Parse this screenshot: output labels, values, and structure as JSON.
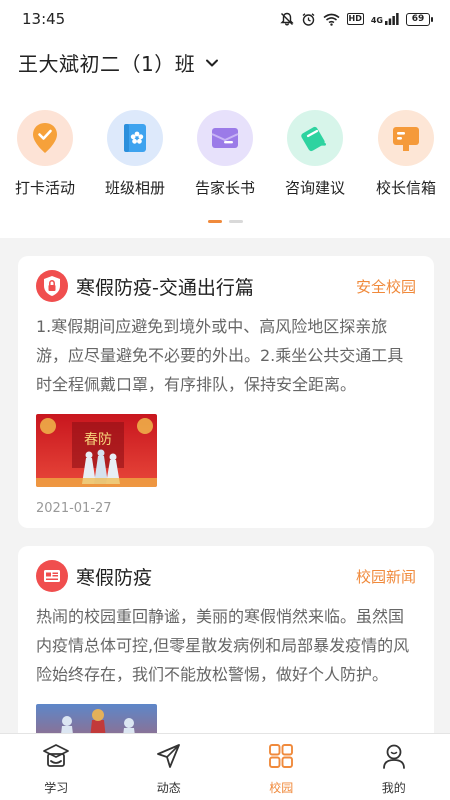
{
  "status_bar": {
    "time": "13:45",
    "network": "HD",
    "signal": "4G",
    "battery": "69"
  },
  "header": {
    "class_name": "王大斌初二（1）班"
  },
  "quick_actions": [
    {
      "label": "打卡活动",
      "icon": "checkin-location-icon",
      "bg": "#fde3d6",
      "color": "#f6a13a"
    },
    {
      "label": "班级相册",
      "icon": "photo-album-icon",
      "bg": "#dde9fb",
      "color": "#3ea3ef"
    },
    {
      "label": "告家长书",
      "icon": "letter-icon",
      "bg": "#e7e1fb",
      "color": "#9b7be8"
    },
    {
      "label": "咨询建议",
      "icon": "feedback-pen-icon",
      "bg": "#d7f5ea",
      "color": "#2ed3a0"
    },
    {
      "label": "校长信箱",
      "icon": "mailbox-icon",
      "bg": "#fde6d6",
      "color": "#f59a3a"
    }
  ],
  "pager": {
    "pages": 2,
    "active": 0
  },
  "feed": [
    {
      "title": "寒假防疫-交通出行篇",
      "tag": "安全校园",
      "icon": "shield-lock-icon",
      "body": "1.寒假期间应避免到境外或中、高风险地区探亲旅游，应尽量避免不必要的外出。2.乘坐公共交通工具时全程佩戴口罩，有序排队，保持安全距离。",
      "date": "2021-01-27"
    },
    {
      "title": "寒假防疫",
      "tag": "校园新闻",
      "icon": "newspaper-icon",
      "body": "热闹的校园重回静谧，美丽的寒假悄然来临。虽然国内疫情总体可控,但零星散发病例和局部暴发疫情的风险始终存在，我们不能放松警惕，做好个人防护。",
      "date": ""
    }
  ],
  "tabs": [
    {
      "label": "学习",
      "icon": "graduation-cap-icon"
    },
    {
      "label": "动态",
      "icon": "paper-plane-icon"
    },
    {
      "label": "校园",
      "icon": "grid-icon"
    },
    {
      "label": "我的",
      "icon": "user-icon"
    }
  ],
  "colors": {
    "accent": "#f08a3c",
    "tag": "#f08a3c",
    "badge_red": "#f04e4e"
  }
}
